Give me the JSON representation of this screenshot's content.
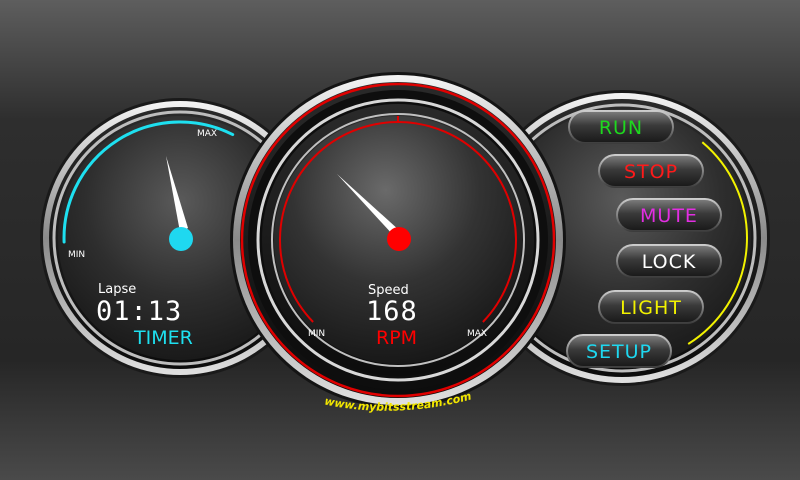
{
  "left_gauge": {
    "min_label": "MIN",
    "max_label": "MAX",
    "caption": "Lapse",
    "value": "01:13",
    "unit": "TIMER",
    "arc_color": "#1ee0f0",
    "hub_color": "#1fd8f0"
  },
  "center_gauge": {
    "min_label": "MIN",
    "max_label": "MAX",
    "caption": "Speed",
    "value": "168",
    "unit": "RPM",
    "arc_color": "#e00000",
    "hub_color": "#ff0000",
    "url": "www.mybitsstream.com",
    "url_color": "#f2e600"
  },
  "right_panel": {
    "arc_color": "#f2f200",
    "buttons": [
      {
        "label": "RUN",
        "color": "#1ed81e"
      },
      {
        "label": "STOP",
        "color": "#ff1a1a"
      },
      {
        "label": "MUTE",
        "color": "#e22ee2"
      },
      {
        "label": "LOCK",
        "color": "#ffffff"
      },
      {
        "label": "LIGHT",
        "color": "#f2f200"
      },
      {
        "label": "SETUP",
        "color": "#1ed8f0"
      }
    ]
  }
}
